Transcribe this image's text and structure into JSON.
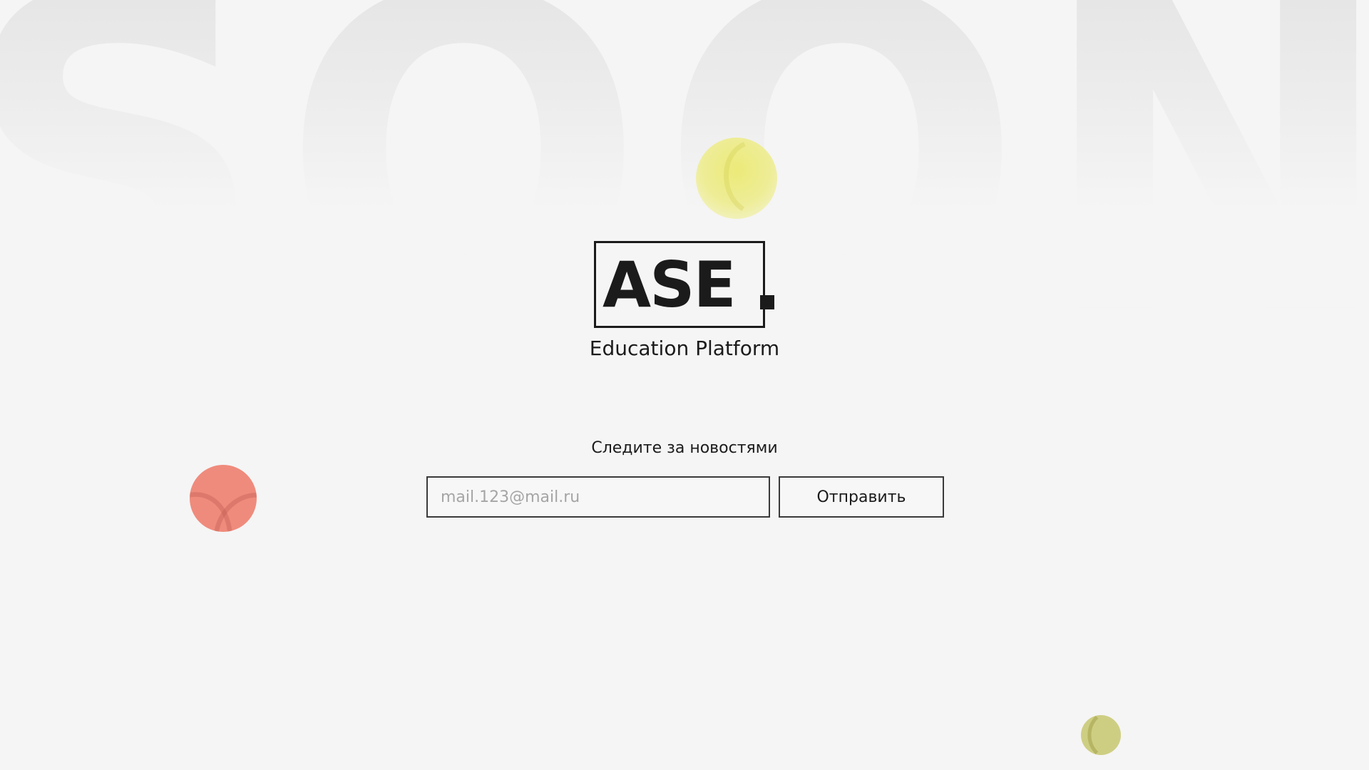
{
  "background": {
    "word": "SOON"
  },
  "logo": {
    "mark": "ASE",
    "subtitle": "Education Platform"
  },
  "newsletter": {
    "heading": "Следите за новостями",
    "email_placeholder": "mail.123@mail.ru",
    "email_value": "",
    "submit_label": "Отправить"
  },
  "colors": {
    "background": "#f5f5f5",
    "text": "#1b1b1b",
    "dot_yellow": "#ecea78",
    "dot_salmon": "#ef8b7c",
    "dot_olive": "#cece83"
  }
}
